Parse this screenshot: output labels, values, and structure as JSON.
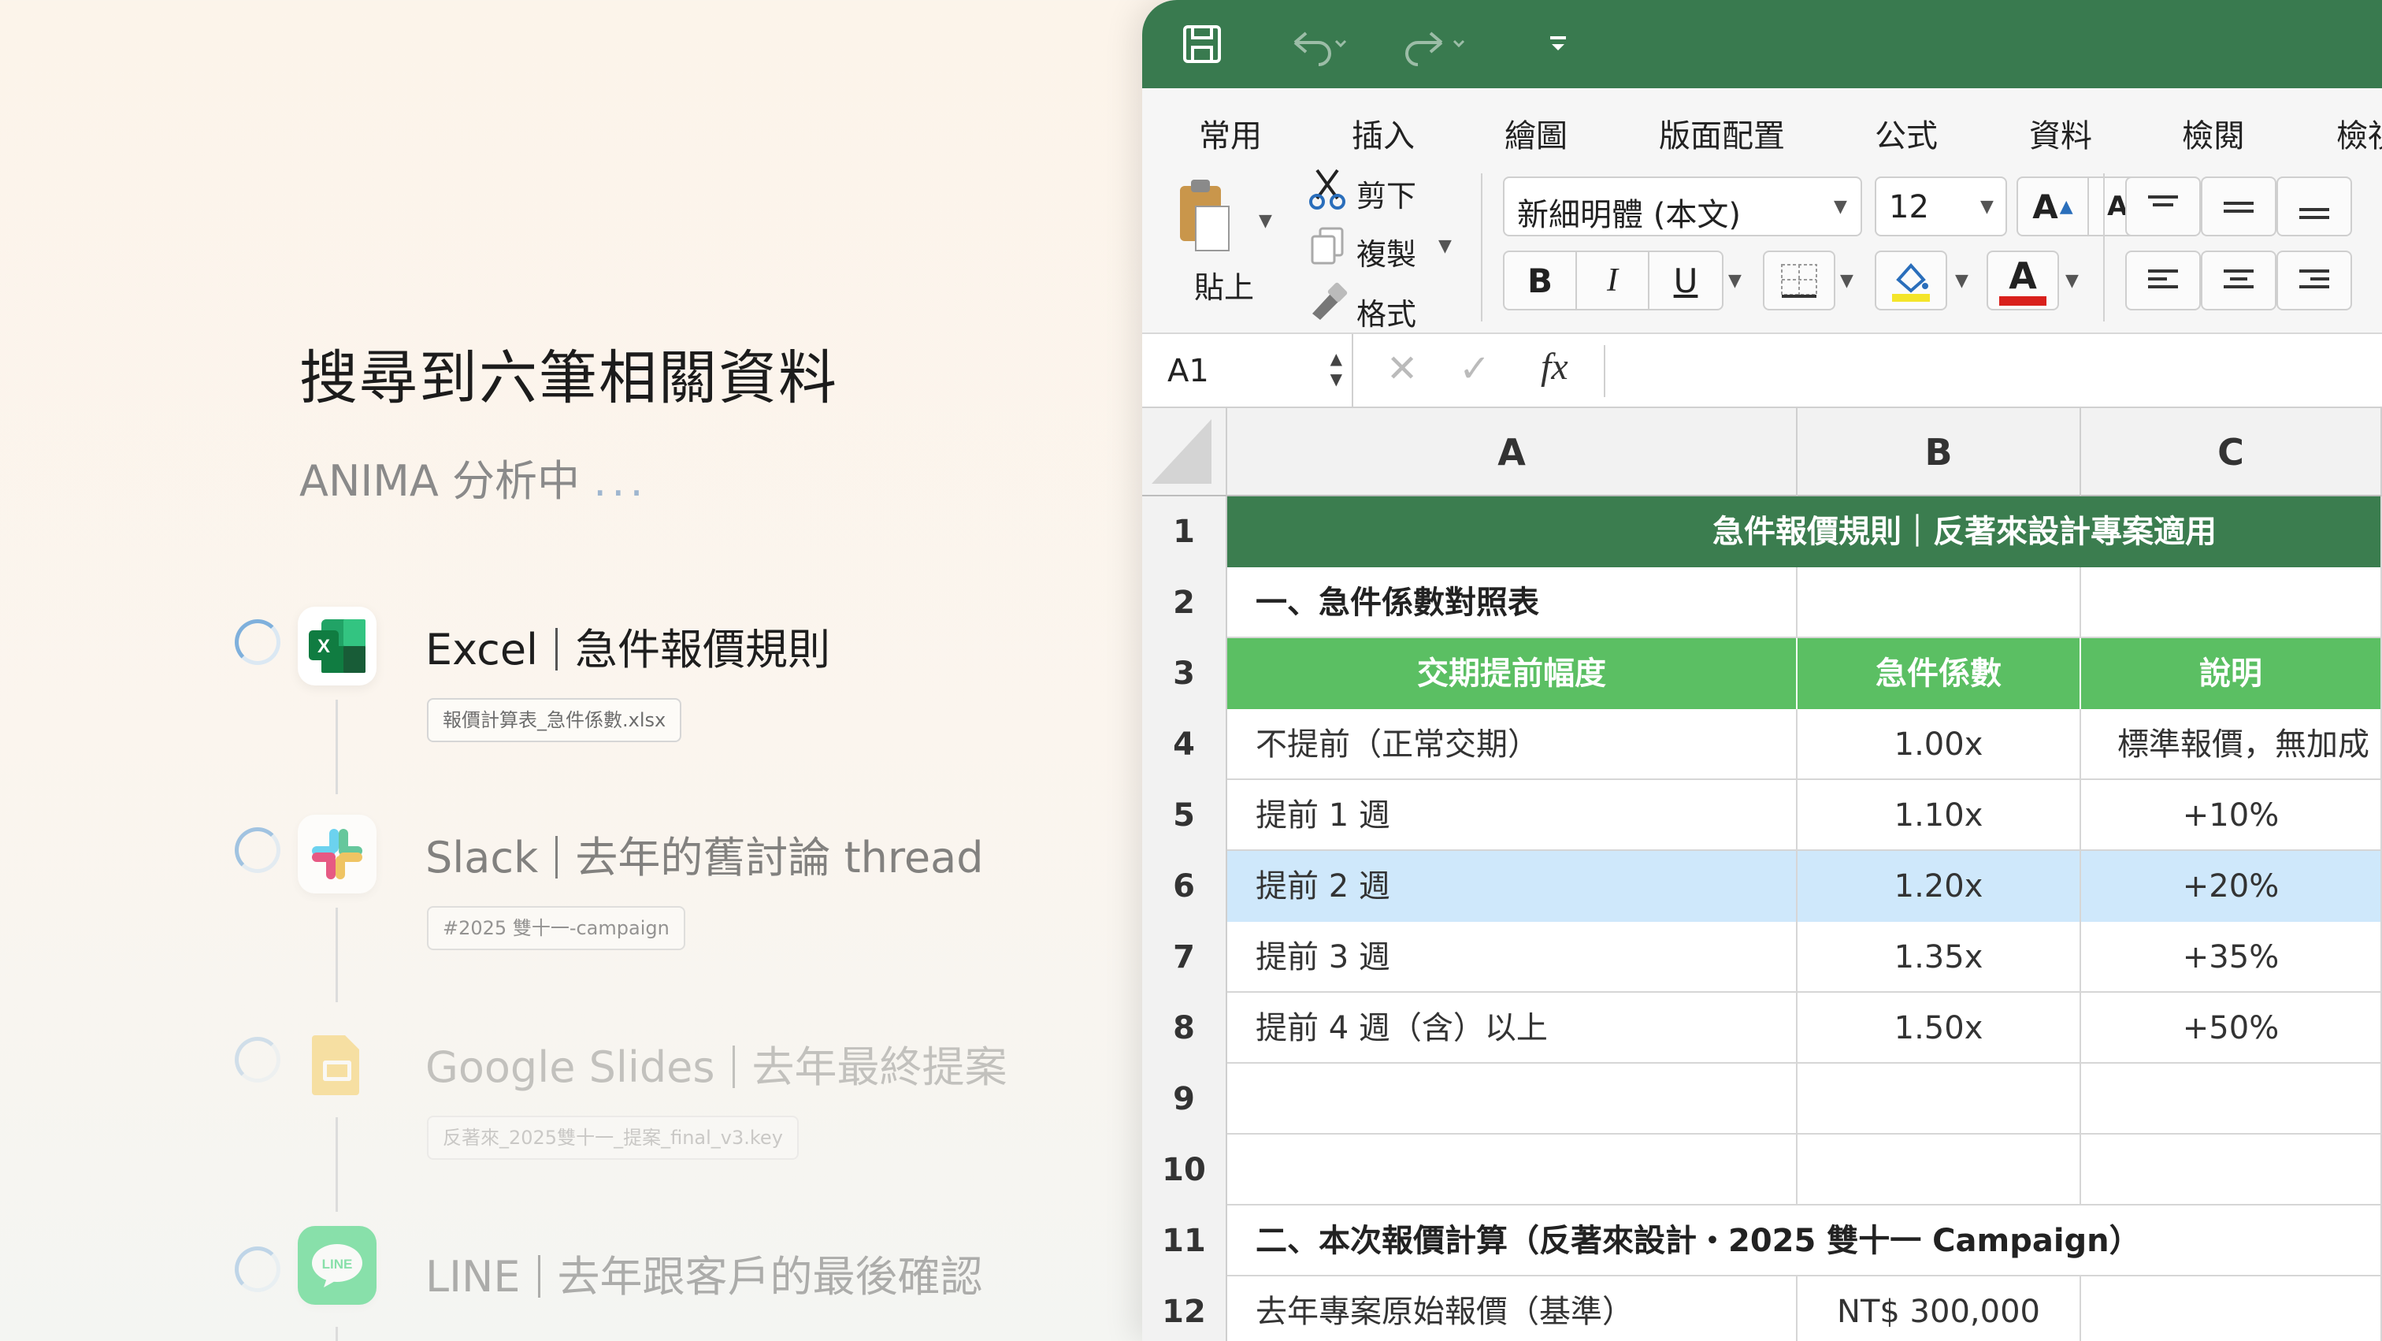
{
  "left": {
    "title": "搜尋到六筆相關資料",
    "subtitle": "ANIMA 分析中",
    "subtitle_dots": "...",
    "results": [
      {
        "app": "Excel",
        "title": "急件報價規則",
        "file": "報價計算表_急件係數.xlsx",
        "icon": "excel-icon"
      },
      {
        "app": "Slack",
        "title": "去年的舊討論 thread",
        "file": "#2025 雙十一-campaign",
        "icon": "slack-icon"
      },
      {
        "app": "Google Slides",
        "title": "去年最終提案",
        "file": "反著來_2025雙十一_提案_final_v3.key",
        "icon": "google-slides-icon"
      },
      {
        "app": "LINE",
        "title": "去年跟客戶的最後確認",
        "file": "",
        "icon": "line-icon"
      }
    ]
  },
  "excel": {
    "tabs": [
      "常用",
      "插入",
      "繪圖",
      "版面配置",
      "公式",
      "資料",
      "檢閱",
      "檢視"
    ],
    "active_tab": "常用",
    "ribbon": {
      "paste": "貼上",
      "cut": "剪下",
      "copy": "複製",
      "format_painter": "格式",
      "font": "新細明體 (本文)",
      "font_size": "12",
      "bold": "B",
      "italic": "I",
      "underline": "U",
      "font_color_letter": "A",
      "grow": "A",
      "shrink": "A"
    },
    "namebox": "A1",
    "fx": "fx",
    "columns": [
      "A",
      "B",
      "C"
    ],
    "header_color": "#3b7d4f",
    "table_header_color": "#5bbf63",
    "selected_row_color": "#cfe8fb",
    "rows": [
      {
        "n": "1",
        "type": "banner",
        "a": "急件報價規則｜反著來設計專案適用"
      },
      {
        "n": "2",
        "type": "section",
        "a": "一、急件係數對照表",
        "b": "",
        "c": ""
      },
      {
        "n": "3",
        "type": "header",
        "a": "交期提前幅度",
        "b": "急件係數",
        "c": "說明"
      },
      {
        "n": "4",
        "type": "data",
        "a": "不提前（正常交期）",
        "b": "1.00x",
        "c": "標準報價，無加成"
      },
      {
        "n": "5",
        "type": "data",
        "a": "提前 1 週",
        "b": "1.10x",
        "c": "+10%"
      },
      {
        "n": "6",
        "type": "selected",
        "a": "提前 2 週",
        "b": "1.20x",
        "c": "+20%"
      },
      {
        "n": "7",
        "type": "data",
        "a": "提前 3 週",
        "b": "1.35x",
        "c": "+35%"
      },
      {
        "n": "8",
        "type": "data",
        "a": "提前 4 週（含）以上",
        "b": "1.50x",
        "c": "+50%"
      },
      {
        "n": "9",
        "type": "data",
        "a": "",
        "b": "",
        "c": ""
      },
      {
        "n": "10",
        "type": "data",
        "a": "",
        "b": "",
        "c": ""
      },
      {
        "n": "11",
        "type": "section-wide",
        "a": "二、本次報價計算（反著來設計・2025 雙十一 Campaign）"
      },
      {
        "n": "12",
        "type": "data",
        "a": "去年專案原始報價（基準）",
        "b": "NT$ 300,000",
        "c": ""
      }
    ]
  }
}
